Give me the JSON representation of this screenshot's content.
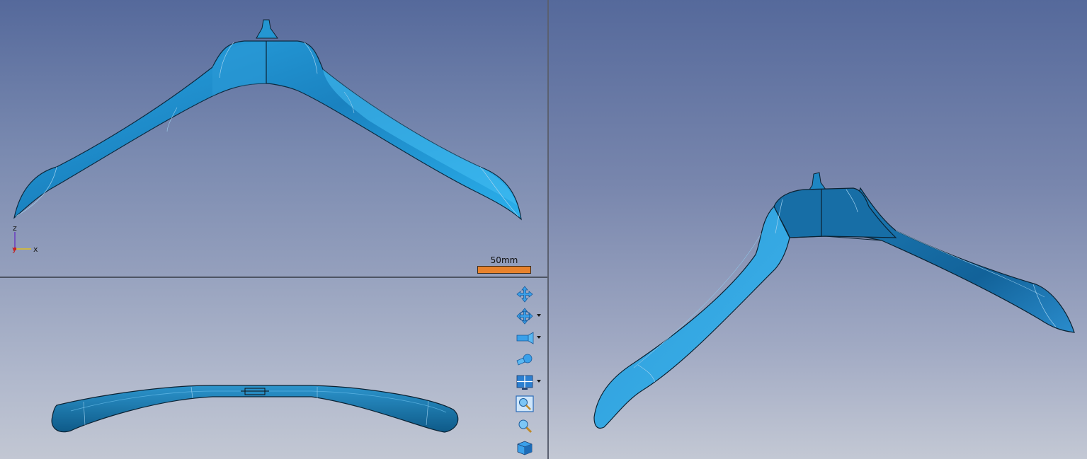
{
  "viewports": {
    "front": {
      "axis": {
        "z": "z",
        "y": "y",
        "x": "x"
      },
      "scale_label": "50mm"
    },
    "top": {},
    "iso": {}
  },
  "toolbar": {
    "items": [
      {
        "name": "pan-icon",
        "dropdown": false
      },
      {
        "name": "rotate-icon",
        "dropdown": true
      },
      {
        "name": "camera-icon",
        "dropdown": true
      },
      {
        "name": "light-icon",
        "dropdown": false
      },
      {
        "name": "layout-icon",
        "dropdown": true
      },
      {
        "name": "zoom-window-icon",
        "dropdown": false
      },
      {
        "name": "zoom-icon",
        "dropdown": false
      },
      {
        "name": "view-cube-icon",
        "dropdown": false
      }
    ]
  },
  "colors": {
    "model": "#2a8fc8",
    "model_dark": "#0f5e8e",
    "scale_bar": "#e8822c"
  }
}
